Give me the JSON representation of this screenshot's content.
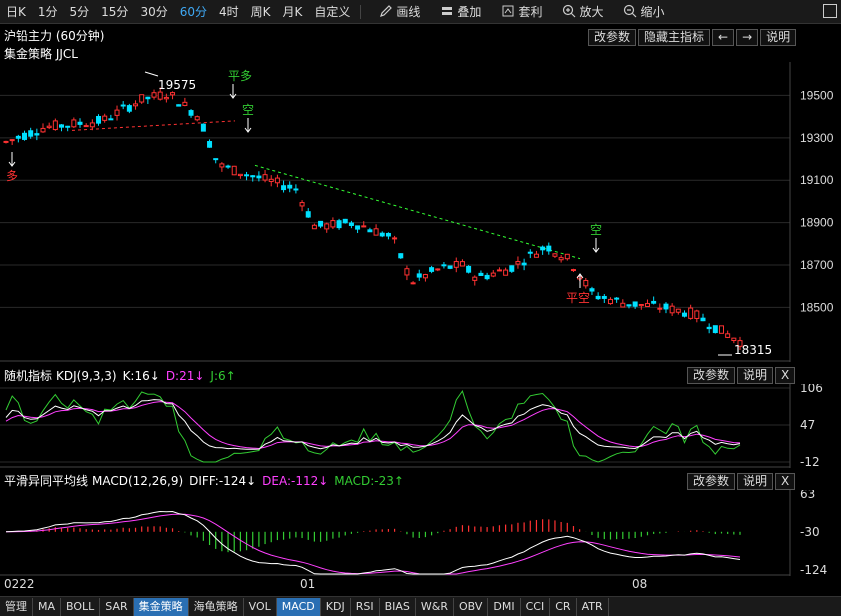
{
  "toolbar": {
    "periods": [
      "日K",
      "1分",
      "5分",
      "15分",
      "30分",
      "60分",
      "4时",
      "周K",
      "月K",
      "自定义"
    ],
    "active_period": "60分",
    "tools": [
      {
        "icon": "pencil-icon",
        "label": "画线"
      },
      {
        "icon": "layers-icon",
        "label": "叠加"
      },
      {
        "icon": "arbitrage-icon",
        "label": "套利"
      },
      {
        "icon": "zoom-in-icon",
        "label": "放大"
      },
      {
        "icon": "zoom-out-icon",
        "label": "缩小"
      }
    ]
  },
  "main_panel": {
    "title": "沪铅主力 (60分钟)",
    "strategy": "集金策略 JJCL",
    "btn_params": "改参数",
    "btn_hide": "隐藏主指标",
    "btn_left": "←",
    "btn_right": "→",
    "btn_help": "说明",
    "y_ticks": [
      "19500",
      "19300",
      "19100",
      "18900",
      "18700",
      "18500"
    ],
    "annotations": {
      "high": "19575",
      "low": "18315",
      "long": "多",
      "close_long": "平多",
      "short": "空",
      "short2": "空",
      "close_short": "平空"
    }
  },
  "kdj_panel": {
    "name": "随机指标",
    "params": "KDJ(9,3,3)",
    "k": "K:16↓",
    "d": "D:21↓",
    "j": "J:6↑",
    "btn_params": "改参数",
    "btn_help": "说明",
    "btn_close": "X",
    "y_ticks": [
      "106",
      "47",
      "-12"
    ]
  },
  "macd_panel": {
    "name": "平滑异同平均线",
    "params": "MACD(12,26,9)",
    "diff": "DIFF:-124↓",
    "dea": "DEA:-112↓",
    "macd": "MACD:-23↑",
    "btn_params": "改参数",
    "btn_help": "说明",
    "btn_close": "X",
    "y_ticks": [
      "63",
      "-30",
      "-124"
    ]
  },
  "dates": [
    "0222",
    "01",
    "08"
  ],
  "bottom_tabs": [
    "管理",
    "MA",
    "BOLL",
    "SAR",
    "集金策略",
    "海龟策略",
    "VOL",
    "MACD",
    "KDJ",
    "RSI",
    "BIAS",
    "W&R",
    "OBV",
    "DMI",
    "CCI",
    "CR",
    "ATR"
  ],
  "active_tabs": [
    "集金策略",
    "MACD"
  ],
  "colors": {
    "up": "#ff3232",
    "down": "#00e0ff",
    "k": "#ffffff",
    "d": "#ff40ff",
    "j": "#33cc33",
    "grid": "#333333",
    "accent": "#3fa9f5"
  }
}
